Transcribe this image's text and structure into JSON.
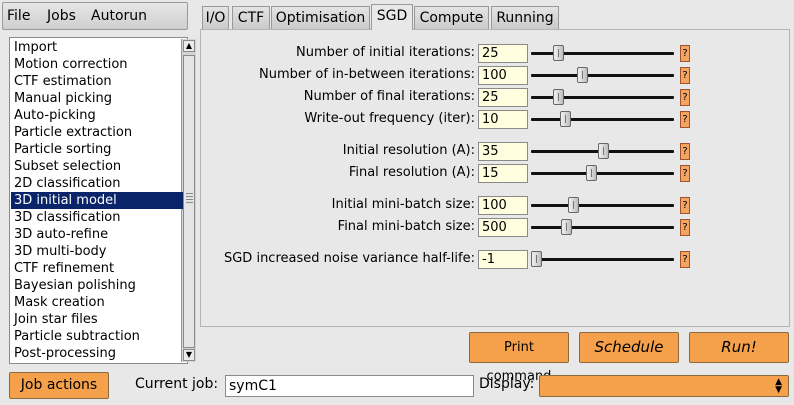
{
  "menubar": {
    "file": "File",
    "jobs": "Jobs",
    "autorun": "Autorun"
  },
  "job_list": {
    "items": [
      "Import",
      "Motion correction",
      "CTF estimation",
      "Manual picking",
      "Auto-picking",
      "Particle extraction",
      "Particle sorting",
      "Subset selection",
      "2D classification",
      "3D initial model",
      "3D classification",
      "3D auto-refine",
      "3D multi-body",
      "CTF refinement",
      "Bayesian polishing",
      "Mask creation",
      "Join star files",
      "Particle subtraction",
      "Post-processing"
    ],
    "selected": "3D initial model",
    "scroll_up_icon": "triangle-up-icon",
    "scroll_down_icon": "triangle-down-icon"
  },
  "tabs": [
    "I/O",
    "CTF",
    "Optimisation",
    "SGD",
    "Compute",
    "Running"
  ],
  "active_tab": "SGD",
  "fields": [
    {
      "label": "Number of initial iterations:",
      "value": "25",
      "slider_level": 0.17
    },
    {
      "label": "Number of in-between iterations:",
      "value": "100",
      "slider_level": 0.35
    },
    {
      "label": "Number of final iterations:",
      "value": "25",
      "slider_level": 0.17
    },
    {
      "label": "Write-out frequency (iter):",
      "value": "10",
      "slider_level": 0.22
    },
    {
      "label": "Initial resolution (A):",
      "value": "35",
      "slider_level": 0.51
    },
    {
      "label": "Final resolution (A):",
      "value": "15",
      "slider_level": 0.42
    },
    {
      "label": "Initial mini-batch size:",
      "value": "100",
      "slider_level": 0.28
    },
    {
      "label": "Final mini-batch size:",
      "value": "500",
      "slider_level": 0.23
    },
    {
      "label": "SGD increased noise variance half-life:",
      "value": "-1",
      "slider_level": 0.0
    }
  ],
  "help_label": "?",
  "buttons": {
    "print": "Print command",
    "schedule": "Schedule",
    "run": "Run!",
    "job_actions": "Job actions"
  },
  "current_job": {
    "label": "Current job:",
    "value": "symC1"
  },
  "display": {
    "label": "Display:",
    "value": ""
  },
  "colors": {
    "button_orange": "#f5a04a",
    "help_orange": "#f4a460",
    "input_bg": "#ffffe0",
    "selection": "#0a246a"
  }
}
